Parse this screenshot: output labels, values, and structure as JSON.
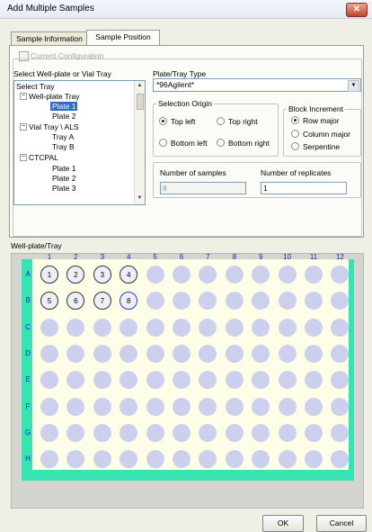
{
  "window": {
    "title": "Add Multiple Samples",
    "close_icon": "close-icon (x)"
  },
  "tabs": [
    {
      "label": "Sample Information",
      "active": false
    },
    {
      "label": "Sample Position",
      "active": true
    }
  ],
  "current_configuration": {
    "label": "Current Configuration",
    "checked": false,
    "enabled": false
  },
  "tray_select": {
    "label": "Select Well-plate or Vial Tray",
    "tree": [
      {
        "label": "Select Tray",
        "level": 0
      },
      {
        "label": "Well-plate Tray",
        "level": 1,
        "expander": "⊟"
      },
      {
        "label": "Plate 1",
        "level": 2,
        "selected": true
      },
      {
        "label": "Plate 2",
        "level": 2
      },
      {
        "label": "Vial Tray \\ ALS",
        "level": 1,
        "expander": "⊟"
      },
      {
        "label": "Tray A",
        "level": 2
      },
      {
        "label": "Tray B",
        "level": 2
      },
      {
        "label": "CTCPAL",
        "level": 1,
        "expander": "⊟"
      },
      {
        "label": "Plate 1",
        "level": 2
      },
      {
        "label": "Plate 2",
        "level": 2
      },
      {
        "label": "Plate 3",
        "level": 2
      }
    ]
  },
  "plate_type": {
    "label": "Plate/Tray Type",
    "value": "*96Agilent*"
  },
  "selection_origin": {
    "label": "Selection Origin",
    "options": [
      "Top left",
      "Top right",
      "Bottom left",
      "Bottom right"
    ],
    "selected": "Top left"
  },
  "block_increment": {
    "label": "Block Increment",
    "options": [
      "Row major",
      "Column major",
      "Serpentine"
    ],
    "selected": "Row major"
  },
  "number_of_samples": {
    "label": "Number of samples",
    "value": "8"
  },
  "number_of_replicates": {
    "label": "Number of replicates",
    "value": "1"
  },
  "plate_view": {
    "label": "Well-plate/Tray",
    "columns": [
      "1",
      "2",
      "3",
      "4",
      "5",
      "6",
      "7",
      "8",
      "9",
      "10",
      "11",
      "12"
    ],
    "rows": [
      "A",
      "B",
      "C",
      "D",
      "E",
      "F",
      "G",
      "H"
    ],
    "selected_wells": [
      {
        "row": "A",
        "col": 1,
        "number": "1"
      },
      {
        "row": "A",
        "col": 2,
        "number": "2"
      },
      {
        "row": "A",
        "col": 3,
        "number": "3"
      },
      {
        "row": "A",
        "col": 4,
        "number": "4"
      },
      {
        "row": "B",
        "col": 1,
        "number": "5"
      },
      {
        "row": "B",
        "col": 2,
        "number": "6"
      },
      {
        "row": "B",
        "col": 3,
        "number": "7"
      },
      {
        "row": "B",
        "col": 4,
        "number": "8",
        "current": true
      }
    ],
    "colors": {
      "plate_border": "#37e3b1",
      "plate_bg": "#fefee8",
      "empty_well": "#cdd0ec",
      "selected_well": "#eceef8",
      "label_color": "#2020d0"
    }
  },
  "buttons": {
    "ok": "OK",
    "cancel": "Cancel"
  }
}
